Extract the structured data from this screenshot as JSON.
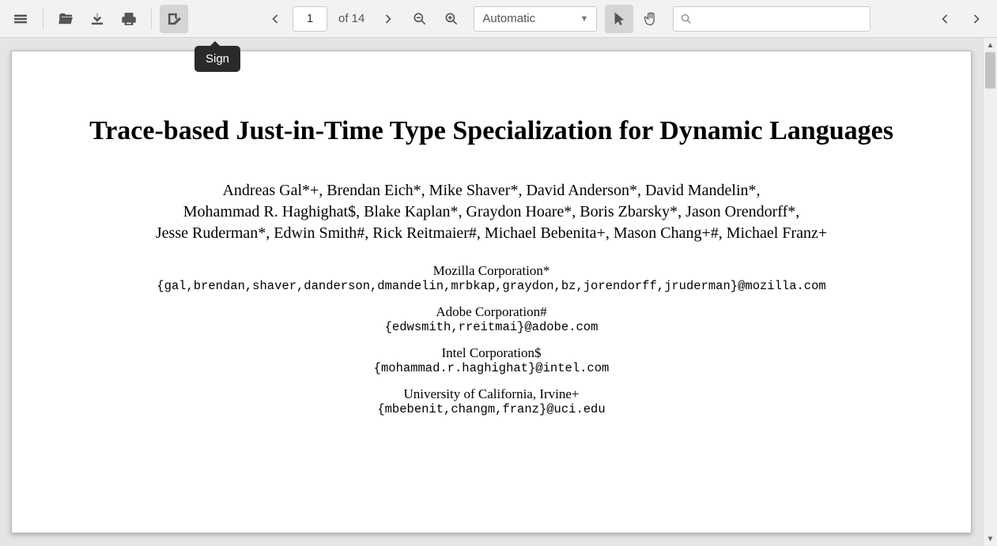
{
  "toolbar": {
    "tooltip_sign": "Sign",
    "page_current": "1",
    "page_total_label": "of 14",
    "zoom_label": "Automatic"
  },
  "paper": {
    "title": "Trace-based Just-in-Time Type Specialization for Dynamic Languages",
    "authors_line1": "Andreas Gal*+, Brendan Eich*, Mike Shaver*, David Anderson*, David Mandelin*,",
    "authors_line2": "Mohammad R. Haghighat$, Blake Kaplan*, Graydon Hoare*, Boris Zbarsky*, Jason Orendorff*,",
    "authors_line3": "Jesse Ruderman*, Edwin Smith#, Rick Reitmaier#, Michael Bebenita+, Mason Chang+#, Michael Franz+",
    "affiliations": [
      {
        "name": "Mozilla Corporation*",
        "email": "{gal,brendan,shaver,danderson,dmandelin,mrbkap,graydon,bz,jorendorff,jruderman}@mozilla.com"
      },
      {
        "name": "Adobe Corporation#",
        "email": "{edwsmith,rreitmai}@adobe.com"
      },
      {
        "name": "Intel Corporation$",
        "email": "{mohammad.r.haghighat}@intel.com"
      },
      {
        "name": "University of California, Irvine+",
        "email": "{mbebenit,changm,franz}@uci.edu"
      }
    ]
  }
}
